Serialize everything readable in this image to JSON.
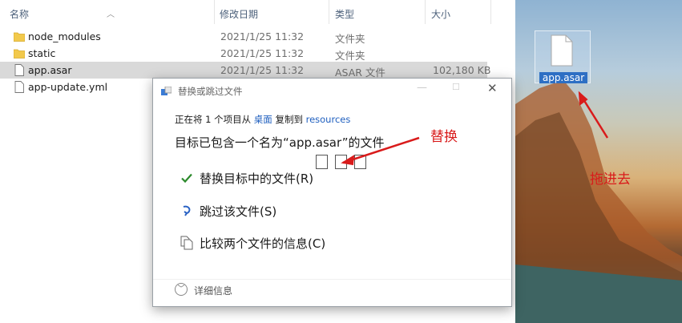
{
  "explorer": {
    "columns": [
      {
        "label": "名称"
      },
      {
        "label": "修改日期"
      },
      {
        "label": "类型"
      },
      {
        "label": "大小"
      }
    ],
    "rows": [
      {
        "name": "node_modules",
        "date": "2021/1/25 11:32",
        "type": "文件夹",
        "size": "",
        "icon": "folder-icon"
      },
      {
        "name": "static",
        "date": "2021/1/25 11:32",
        "type": "文件夹",
        "size": "",
        "icon": "folder-icon"
      },
      {
        "name": "app.asar",
        "date": "2021/1/25 11:32",
        "type": "ASAR 文件",
        "size": "102,180 KB",
        "icon": "file-icon",
        "selected": true
      },
      {
        "name": "app-update.yml",
        "date": "",
        "type": "",
        "size": "",
        "icon": "file-icon"
      }
    ]
  },
  "desktop": {
    "file_label": "app.asar"
  },
  "dialog": {
    "title": "替换或跳过文件",
    "copy_prefix": "正在将 1 个项目从 ",
    "copy_source": "桌面",
    "copy_middle": " 复制到 ",
    "copy_dest": "resources",
    "message": "目标已包含一个名为“app.asar”的文件",
    "options": [
      {
        "label": "替换目标中的文件(R)",
        "icon": "checkmark-icon"
      },
      {
        "label": "跳过该文件(S)",
        "icon": "skip-icon"
      },
      {
        "label": "比较两个文件的信息(C)",
        "icon": "compare-icon"
      }
    ],
    "details_label": "详细信息"
  },
  "annotations": {
    "replace": "替换",
    "drag_in": "拖进去"
  },
  "colors": {
    "accent_link": "#1f5fbf",
    "annotation_red": "#d91b1b",
    "check_green": "#2c8a2c",
    "folder_yellow": "#f2c94c",
    "selection_bg": "#d9d9d9"
  }
}
